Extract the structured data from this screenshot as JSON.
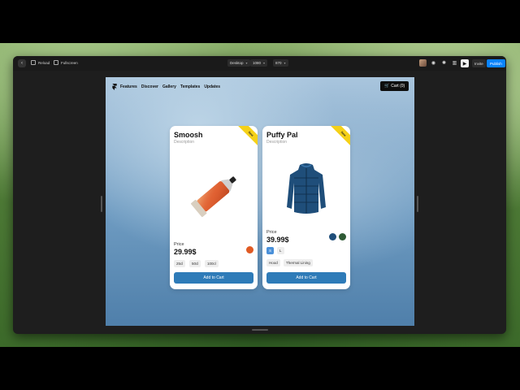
{
  "toolbar": {
    "back_icon": "chevron-left-icon",
    "reload_label": "Reload",
    "fullscreen_label": "Fullscreen",
    "device_value": "Desktop",
    "width_value": "1080",
    "height_value": "870",
    "invite_label": "Invite",
    "publish_label": "Publish",
    "publish_color": "#0a84ff"
  },
  "site": {
    "nav": [
      "Features",
      "Discover",
      "Gallery",
      "Templates",
      "Updates"
    ],
    "cart_label": "Cart (0)"
  },
  "products": [
    {
      "title": "Smoosh",
      "description": "Description",
      "ribbon": "New",
      "price_label": "Price",
      "price": "29.99$",
      "swatches": [
        "#e05a23"
      ],
      "options": [
        "25cl",
        "50cl",
        "100cl"
      ],
      "button": "Add to Cart"
    },
    {
      "title": "Puffy Pal",
      "description": "Description",
      "ribbon": "New",
      "price_label": "Price",
      "price": "39.99$",
      "swatches": [
        "#1f4e7a",
        "#2e5a35"
      ],
      "sizes": [
        "S",
        "L"
      ],
      "features": [
        "Hood",
        "Thermal Lining"
      ],
      "button": "Add to Cart"
    }
  ]
}
